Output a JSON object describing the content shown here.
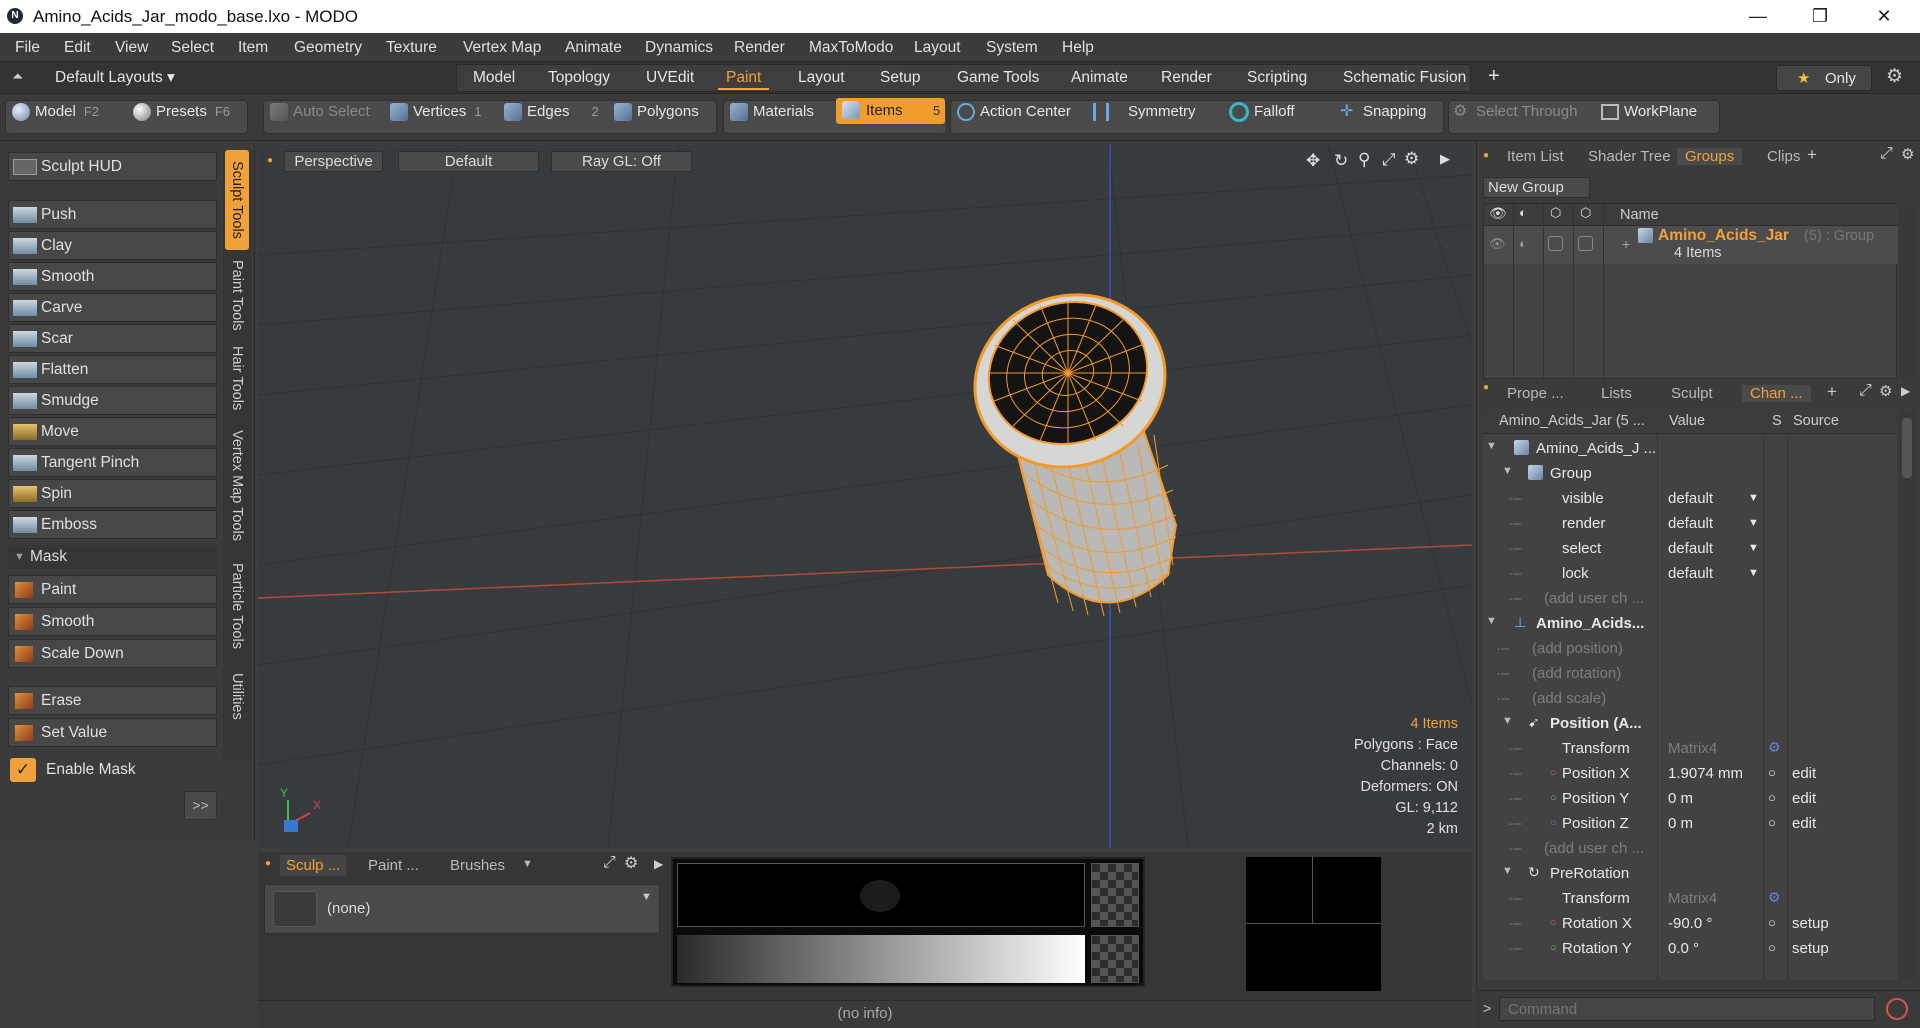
{
  "app": {
    "title": "Amino_Acids_Jar_modo_base.lxo - MODO"
  },
  "window_controls": {
    "minimize": "—",
    "restore": "❐",
    "close": "✕"
  },
  "menu": [
    "File",
    "Edit",
    "View",
    "Select",
    "Item",
    "Geometry",
    "Texture",
    "Vertex Map",
    "Animate",
    "Dynamics",
    "Render",
    "MaxToModo",
    "Layout",
    "System",
    "Help"
  ],
  "layouts": {
    "default": "Default Layouts ▾",
    "tabs": [
      "Model",
      "Topology",
      "UVEdit",
      "Paint",
      "Layout",
      "Setup",
      "Game Tools",
      "Animate",
      "Render",
      "Scripting",
      "Schematic Fusion"
    ],
    "active": "Paint",
    "add": "+",
    "only": "Only"
  },
  "toolbar": {
    "model": "Model",
    "model_key": "F2",
    "presets": "Presets",
    "presets_key": "F6",
    "auto_select": "Auto Select",
    "vertices": "Vertices",
    "vertices_key": "1",
    "edges": "Edges",
    "edges_key": "2",
    "polygons": "Polygons",
    "materials": "Materials",
    "items": "Items",
    "items_key": "5",
    "action_center": "Action Center",
    "symmetry": "Symmetry",
    "falloff": "Falloff",
    "snapping": "Snapping",
    "select_through": "Select Through",
    "workplane": "WorkPlane"
  },
  "left": {
    "hud": "Sculpt HUD",
    "tools": [
      "Push",
      "Clay",
      "Smooth",
      "Carve",
      "Scar",
      "Flatten",
      "Smudge",
      "Move",
      "Tangent Pinch",
      "Spin",
      "Emboss"
    ],
    "mask_header": "Mask",
    "mask_tools": [
      "Paint",
      "Smooth",
      "Scale Down"
    ],
    "erase": "Erase",
    "set_value": "Set Value",
    "enable_mask": "Enable Mask",
    "expand": ">>",
    "vtabs": [
      "Sculpt Tools",
      "Paint Tools",
      "Hair Tools",
      "Vertex Map Tools",
      "Particle Tools",
      "Utilities"
    ]
  },
  "viewport": {
    "view": "Perspective",
    "shading": "Default",
    "raygl": "Ray GL: Off",
    "info": {
      "items": "4 Items",
      "polygons": "Polygons : Face",
      "channels": "Channels: 0",
      "deformers": "Deformers: ON",
      "gl": "GL: 9,112",
      "scale": "2 km"
    }
  },
  "bottom": {
    "tabs": [
      "Sculp ...",
      "Paint ...",
      "Brushes"
    ],
    "brush": "(none)",
    "status": "(no info)"
  },
  "groups": {
    "tabs": [
      "Item List",
      "Shader Tree",
      "Groups",
      "Clips"
    ],
    "active": "Groups",
    "new_group": "New Group",
    "col_name": "Name",
    "group_name": "Amino_Acids_Jar",
    "group_suffix": "(5) : Group",
    "group_count": "4 Items"
  },
  "channels": {
    "tabs": [
      "Prope ...",
      "Lists",
      "Sculpt",
      "Chan ..."
    ],
    "active": "Chan ...",
    "headers": [
      "Amino_Acids_Jar (5 ...",
      "Value",
      "S",
      "Source"
    ],
    "rows": [
      {
        "name": "Amino_Acids_J ...",
        "value": "",
        "src": ""
      },
      {
        "name": "Group",
        "value": "",
        "src": ""
      },
      {
        "name": "visible",
        "value": "default",
        "src": ""
      },
      {
        "name": "render",
        "value": "default",
        "src": ""
      },
      {
        "name": "select",
        "value": "default",
        "src": ""
      },
      {
        "name": "lock",
        "value": "default",
        "src": ""
      },
      {
        "name": "(add user ch ...",
        "value": "",
        "src": ""
      },
      {
        "name": "Amino_Acids...",
        "value": "",
        "src": ""
      },
      {
        "name": "(add position)",
        "value": "",
        "src": ""
      },
      {
        "name": "(add rotation)",
        "value": "",
        "src": ""
      },
      {
        "name": "(add scale)",
        "value": "",
        "src": ""
      },
      {
        "name": "Position (A...",
        "value": "",
        "src": ""
      },
      {
        "name": "Transform",
        "value": "Matrix4",
        "src": ""
      },
      {
        "name": "Position X",
        "value": "1.9074 mm",
        "src": "edit"
      },
      {
        "name": "Position Y",
        "value": "0 m",
        "src": "edit"
      },
      {
        "name": "Position Z",
        "value": "0 m",
        "src": "edit"
      },
      {
        "name": "(add user ch ...",
        "value": "",
        "src": ""
      },
      {
        "name": "PreRotation",
        "value": "",
        "src": ""
      },
      {
        "name": "Transform",
        "value": "Matrix4",
        "src": ""
      },
      {
        "name": "Rotation X",
        "value": "-90.0 °",
        "src": "setup"
      },
      {
        "name": "Rotation Y",
        "value": "0.0 °",
        "src": "setup"
      }
    ]
  },
  "command": {
    "placeholder": "Command"
  },
  "colors": {
    "accent": "#f1a13a",
    "axis_x": "#c0392b",
    "axis_y": "#3a4fbf"
  }
}
